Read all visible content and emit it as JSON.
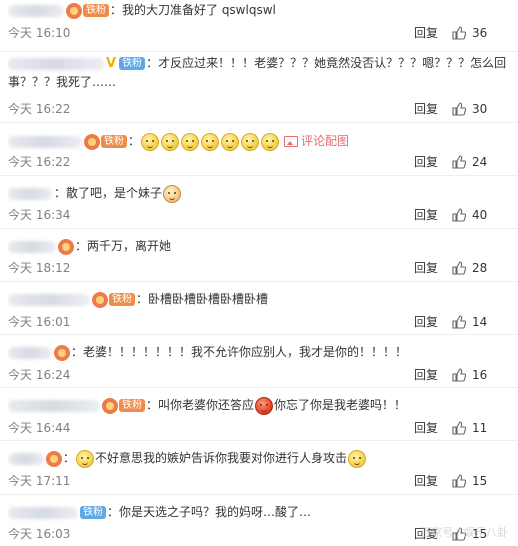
{
  "comments": [
    {
      "pre": "：我的大刀准备好了  qswlqswl",
      "time": "今天 16:10",
      "reply": "回复",
      "likes": "36"
    },
    {
      "badge": "铁粉",
      "pre": "：才反应过来！！！老婆？？？她竟然没否认？？？嗯？？？怎么回事？？？我死了……",
      "time": "今天 16:22",
      "reply": "回复",
      "likes": "30"
    },
    {
      "badge": "铁粉",
      "pre": "：",
      "pic_link": "评论配图",
      "time": "今天 16:22",
      "reply": "回复",
      "likes": "24"
    },
    {
      "pre": "：散了吧，是个妹子",
      "time": "今天 16:34",
      "reply": "回复",
      "likes": "40"
    },
    {
      "pre": "：两千万，离开她",
      "time": "今天 18:12",
      "reply": "回复",
      "likes": "28"
    },
    {
      "badge": "铁粉",
      "pre": "：卧槽卧槽卧槽卧槽卧槽",
      "time": "今天 16:01",
      "reply": "回复",
      "likes": "14"
    },
    {
      "pre": "：老婆！！！！！！！我不允许你应别人，我才是你的！！！！",
      "time": "今天 16:24",
      "reply": "回复",
      "likes": "16"
    },
    {
      "badge": "铁粉",
      "pre": "：叫你老婆你还答应",
      "post": "你忘了你是我老婆吗！！",
      "time": "今天 16:44",
      "reply": "回复",
      "likes": "11"
    },
    {
      "pre": "：",
      "post": "不好意思我的嫉妒告诉你我要对你进行人身攻击",
      "time": "今天 17:11",
      "reply": "回复",
      "likes": "15"
    },
    {
      "badge": "铁粉",
      "pre": "：你是天选之子吗？我的妈呀…酸了…",
      "time": "今天 16:03",
      "reply": "回复",
      "likes": "15"
    }
  ],
  "watermark": "百家号 / 娱乐八卦",
  "colors": {
    "fan_badge": "#f08c4a",
    "fan_badge_blue": "#5fa8e8",
    "pic_link": "#e86a6a",
    "time": "#808080"
  },
  "icons": {
    "like": "thumbs-up-icon",
    "medal": "fan-medal-icon",
    "pic": "picture-icon",
    "verified": "verified-v-icon"
  }
}
